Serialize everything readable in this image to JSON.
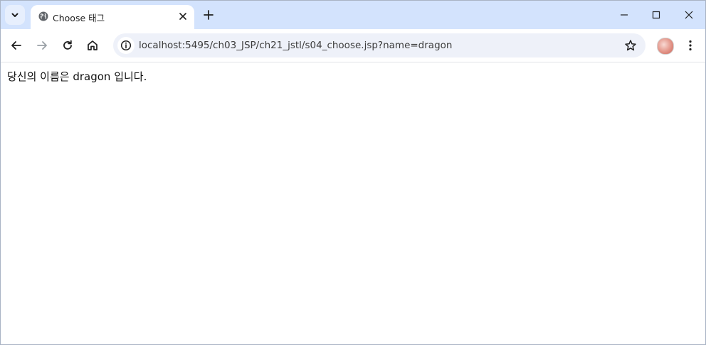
{
  "browser": {
    "tab": {
      "title": "Choose 태그",
      "favicon": "globe-icon"
    },
    "address_bar": {
      "url": "localhost:5495/ch03_JSP/ch21_jstl/s04_choose.jsp?name=dragon"
    },
    "icons": {
      "tab_search": "chevron-down-icon",
      "new_tab": "plus-icon",
      "minimize": "minimize-icon",
      "maximize": "maximize-icon",
      "close": "close-icon",
      "back": "back-arrow-icon",
      "forward": "forward-arrow-icon",
      "reload": "reload-icon",
      "home": "home-icon",
      "site_info": "info-icon",
      "bookmark": "star-icon",
      "menu": "kebab-menu-icon"
    },
    "colors": {
      "tabstrip": "#d3e3fd",
      "omnibox": "#eef1f9"
    }
  },
  "page": {
    "body_text": "당신의 이름은 dragon 입니다."
  }
}
